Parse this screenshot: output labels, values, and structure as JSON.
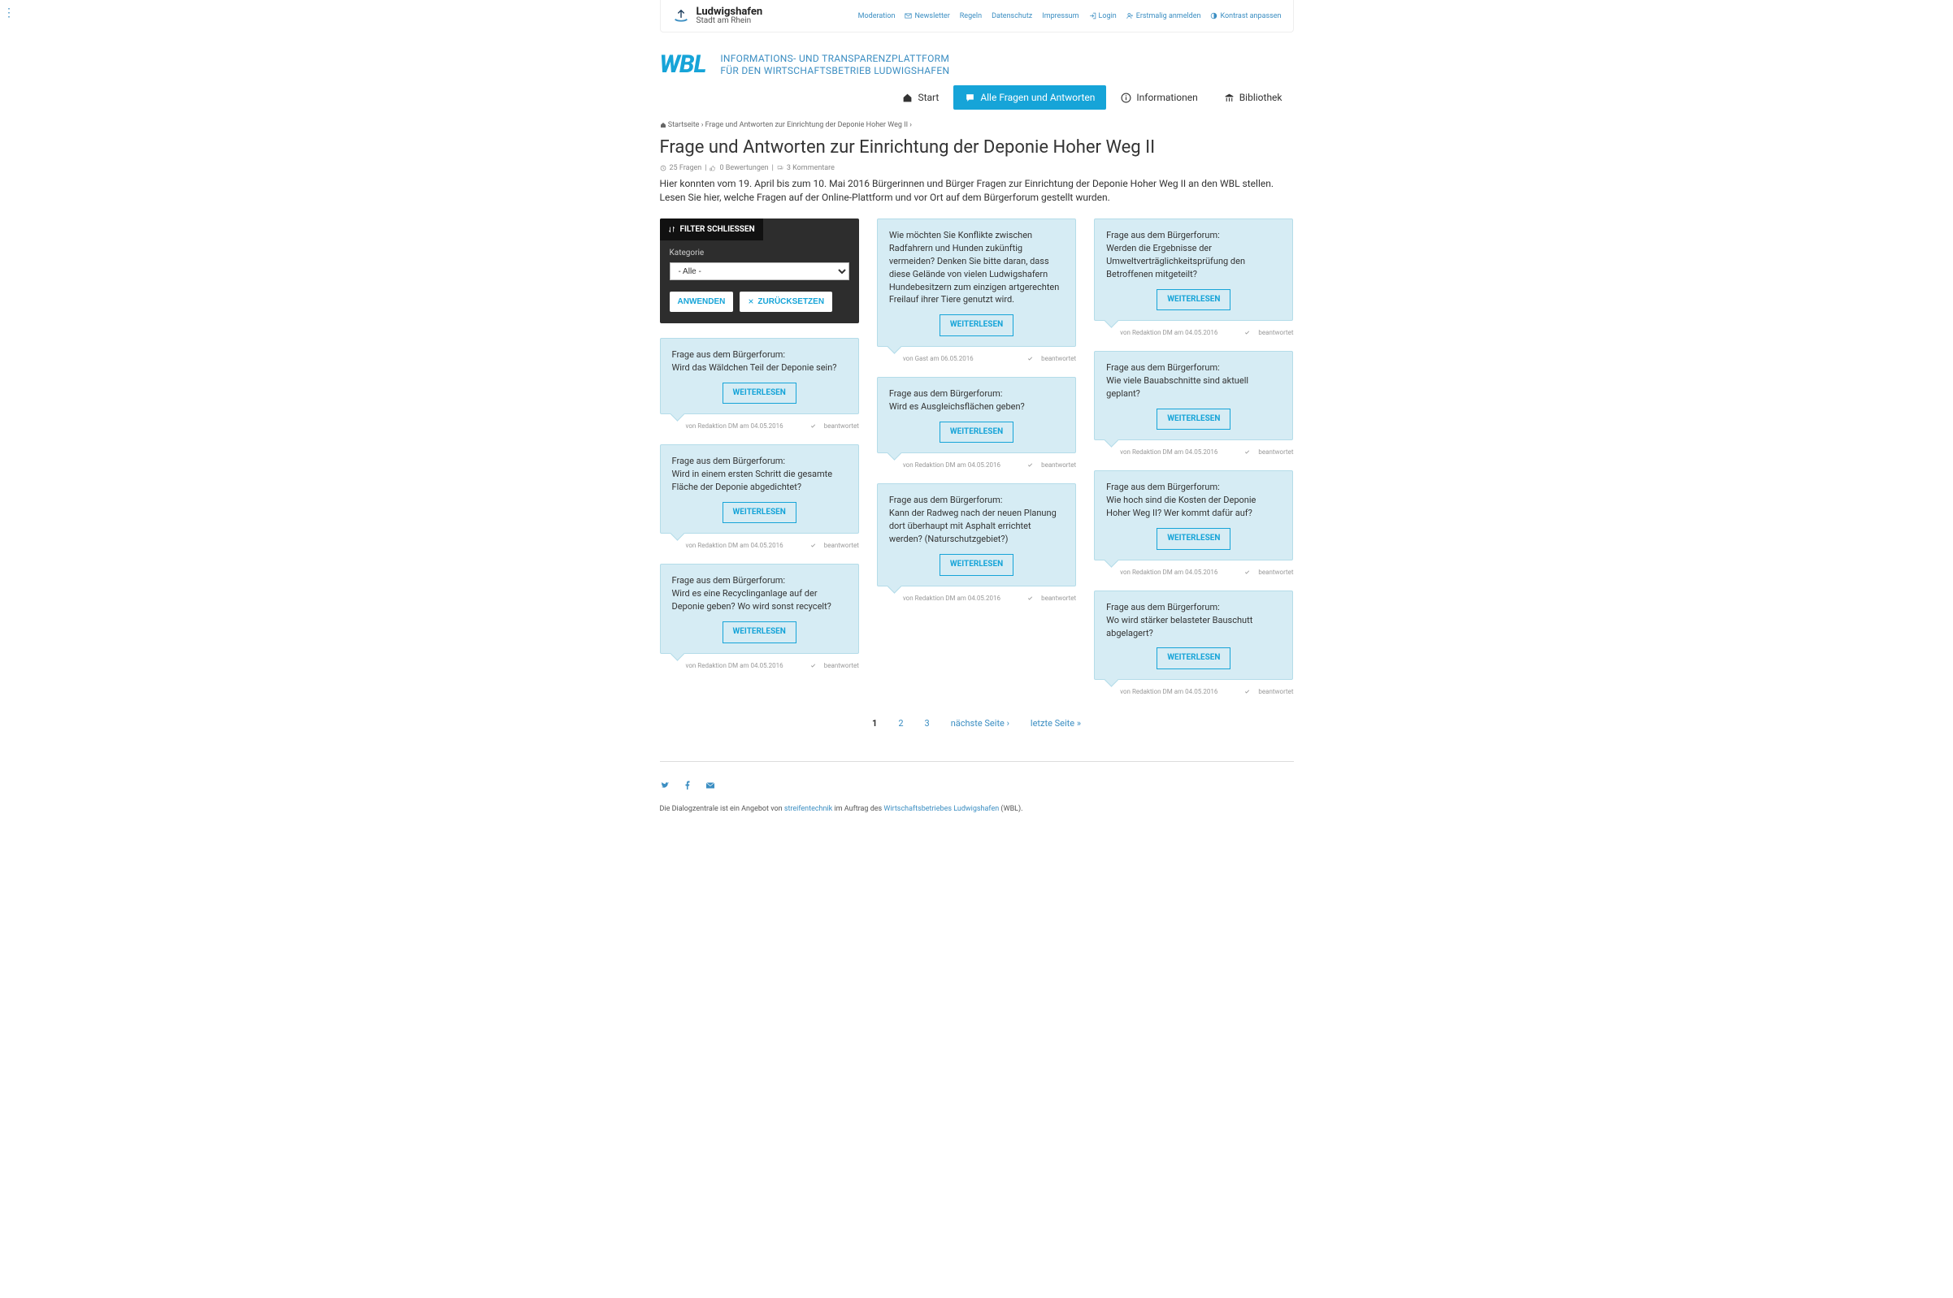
{
  "brand": {
    "title": "Ludwigshafen",
    "subtitle": "Stadt am Rhein"
  },
  "topnav": [
    {
      "label": "Moderation",
      "icon": null
    },
    {
      "label": "Newsletter",
      "icon": "mail"
    },
    {
      "label": "Regeln",
      "icon": null
    },
    {
      "label": "Datenschutz",
      "icon": null
    },
    {
      "label": "Impressum",
      "icon": null
    },
    {
      "label": "Login",
      "icon": "login"
    },
    {
      "label": "Erstmalig anmelden",
      "icon": "user-plus"
    },
    {
      "label": "Kontrast anpassen",
      "icon": "contrast"
    }
  ],
  "wbl": {
    "logo": "WBL",
    "tagline1": "INFORMATIONS- UND TRANSPARENZPLATTFORM",
    "tagline2": "FÜR DEN WIRTSCHAFTSBETRIEB LUDWIGSHAFEN"
  },
  "mainnav": {
    "start": "Start",
    "qa": "Alle Fragen und Antworten",
    "info": "Informationen",
    "lib": "Bibliothek"
  },
  "breadcrumb": {
    "home": "Startseite",
    "current": "Frage und Antworten zur Einrichtung der Deponie Hoher Weg II"
  },
  "page": {
    "title": "Frage und Antworten zur Einrichtung der Deponie Hoher Weg II",
    "meta_questions": "25 Fragen",
    "meta_ratings": "0 Bewertungen",
    "meta_comments": "3 Kommentare",
    "intro": "Hier konnten vom 19. April bis zum 10. Mai 2016 Bürgerinnen und Bürger Fragen zur Einrichtung der Deponie Hoher Weg II an den WBL stellen. Lesen Sie hier, welche Fragen auf der Online-Plattform und vor Ort auf dem Bürgerforum gestellt wurden."
  },
  "filter": {
    "toggle": "FILTER SCHLIESSEN",
    "cat_label": "Kategorie",
    "cat_value": "- Alle -",
    "apply": "ANWENDEN",
    "reset": "ZURÜCKSETZEN"
  },
  "labels": {
    "read_more": "WEITERLESEN",
    "answered": "beantwortet",
    "by": "von",
    "on": "am"
  },
  "columns": [
    [
      {
        "text": "Frage aus dem Bürgerforum:\nWird das Wäldchen Teil der Deponie sein?",
        "author": "Redaktion DM",
        "date": "04.05.2016"
      },
      {
        "text": "Frage aus dem Bürgerforum:\nWird in einem ersten Schritt die gesamte Fläche der Deponie abgedichtet?",
        "author": "Redaktion DM",
        "date": "04.05.2016"
      },
      {
        "text": "Frage aus dem Bürgerforum:\nWird es eine Recyclinganlage auf der Deponie geben? Wo wird sonst recycelt?",
        "author": "Redaktion DM",
        "date": "04.05.2016"
      }
    ],
    [
      {
        "text": "Wie möchten Sie Konflikte zwischen Radfahrern und Hunden zukünftig vermeiden? Denken Sie bitte daran, dass diese Gelände von vielen Ludwigshafern Hundebesitzern zum einzigen artgerechten Freilauf ihrer Tiere genutzt wird.",
        "author": "Gast",
        "date": "06.05.2016"
      },
      {
        "text": "Frage aus dem Bürgerforum:\nWird es Ausgleichsflächen geben?",
        "author": "Redaktion DM",
        "date": "04.05.2016"
      },
      {
        "text": "Frage aus dem Bürgerforum:\nKann der Radweg nach der neuen Planung dort überhaupt mit Asphalt errichtet werden? (Naturschutzgebiet?)",
        "author": "Redaktion DM",
        "date": "04.05.2016"
      }
    ],
    [
      {
        "text": "Frage aus dem Bürgerforum:\nWerden die Ergebnisse der Umweltverträglichkeitsprüfung den Betroffenen mitgeteilt?",
        "author": "Redaktion DM",
        "date": "04.05.2016"
      },
      {
        "text": "Frage aus dem Bürgerforum:\nWie viele Bauabschnitte sind aktuell geplant?",
        "author": "Redaktion DM",
        "date": "04.05.2016"
      },
      {
        "text": "Frage aus dem Bürgerforum:\nWie hoch sind die Kosten der Deponie Hoher Weg II? Wer kommt dafür auf?",
        "author": "Redaktion DM",
        "date": "04.05.2016"
      },
      {
        "text": "Frage aus dem Bürgerforum:\nWo wird stärker belasteter Bauschutt abgelagert?",
        "author": "Redaktion DM",
        "date": "04.05.2016"
      }
    ]
  ],
  "pager": {
    "p1": "1",
    "p2": "2",
    "p3": "3",
    "next": "nächste Seite ›",
    "last": "letzte Seite »"
  },
  "footer": {
    "text1": "Die Dialogzentrale ist ein Angebot von ",
    "link1": "streifentechnik",
    "text2": " im Auftrag des ",
    "link2": "Wirtschaftsbetriebes Ludwigshafen",
    "text3": " (WBL)."
  }
}
